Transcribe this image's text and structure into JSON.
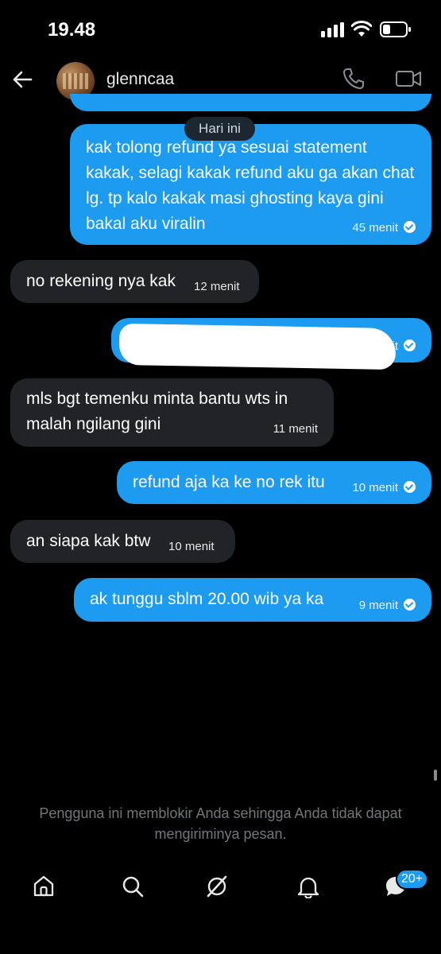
{
  "status_bar": {
    "time": "19.48"
  },
  "header": {
    "username": "glenncaa"
  },
  "date_separator": "Hari ini",
  "messages": [
    {
      "direction": "sent",
      "text": "kak tolong refund ya sesuai statement kakak, selagi kakak refund aku ga akan chat lg. tp kalo kakak masi ghosting kaya gini bakal aku viralin",
      "time": "45 menit"
    },
    {
      "direction": "received",
      "text": "no rekening nya kak",
      "time": "12 menit"
    },
    {
      "direction": "sent",
      "text": "",
      "time": "it"
    },
    {
      "direction": "received",
      "text": "mls bgt temenku minta bantu wts in malah ngilang gini",
      "time": "11 menit"
    },
    {
      "direction": "sent",
      "text": "refund aja ka ke no rek itu",
      "time": "10 menit"
    },
    {
      "direction": "received",
      "text": "an siapa kak btw",
      "time": "10 menit"
    },
    {
      "direction": "sent",
      "text": "ak tunggu sblm 20.00 wib ya ka",
      "time": "9 menit"
    }
  ],
  "blocked_notice": "Pengguna ini memblokir Anda sehingga Anda tidak dapat mengiriminya pesan.",
  "bottom_nav": {
    "items": [
      {
        "icon": "home-icon"
      },
      {
        "icon": "search-icon"
      },
      {
        "icon": "grok-icon"
      },
      {
        "icon": "bell-icon"
      },
      {
        "icon": "messages-icon"
      }
    ],
    "messages_badge": "20+"
  },
  "colors": {
    "accent": "#1d9bf0",
    "received_bubble": "#202327",
    "background": "#000000"
  }
}
